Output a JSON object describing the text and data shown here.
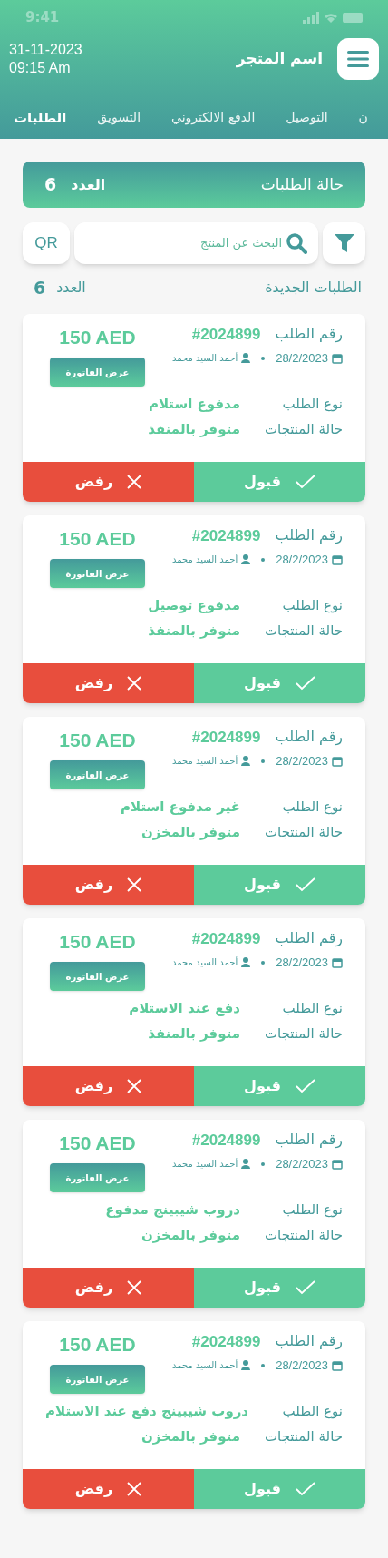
{
  "status_bar": {
    "time": "9:41"
  },
  "header": {
    "title": "اسم المتجر",
    "date": "31-11-2023",
    "time": "09:15 Am"
  },
  "tabs": [
    {
      "label": "ن",
      "selected": false
    },
    {
      "label": "التوصيل",
      "selected": false
    },
    {
      "label": "الدفع الالكتروني",
      "selected": false
    },
    {
      "label": "التسويق",
      "selected": false
    },
    {
      "label": "الطلبات",
      "selected": true
    }
  ],
  "status_card": {
    "title": "حالة الطلبات",
    "count_label": "العدد",
    "count": "6"
  },
  "search": {
    "placeholder": "البحث عن المنتج",
    "qr": "QR"
  },
  "section": {
    "title": "الطلبات الجديدة",
    "count_label": "العدد",
    "count": "6"
  },
  "orders": [
    {
      "order_label": "رقم الطلب",
      "order_number": "#2024899",
      "date": "28/2/2023",
      "customer": "أحمد السيد محمد",
      "price": "150 AED",
      "invoice": "عرض الفاتورة",
      "type_label": "نوع الطلب",
      "type_value": "مدفوع استلام",
      "status_label": "حالة المنتجات",
      "status_value": "متوفر بالمنفذ",
      "accept": "قبول",
      "reject": "رفض"
    },
    {
      "order_label": "رقم الطلب",
      "order_number": "#2024899",
      "date": "28/2/2023",
      "customer": "أحمد السيد محمد",
      "price": "150 AED",
      "invoice": "عرض الفاتورة",
      "type_label": "نوع الطلب",
      "type_value": "مدفوع توصيل",
      "status_label": "حالة المنتجات",
      "status_value": "متوفر بالمنفذ",
      "accept": "قبول",
      "reject": "رفض"
    },
    {
      "order_label": "رقم الطلب",
      "order_number": "#2024899",
      "date": "28/2/2023",
      "customer": "أحمد السيد محمد",
      "price": "150 AED",
      "invoice": "عرض الفاتورة",
      "type_label": "نوع الطلب",
      "type_value": "غير مدفوع استلام",
      "status_label": "حالة المنتجات",
      "status_value": "متوفر بالمخزن",
      "accept": "قبول",
      "reject": "رفض"
    },
    {
      "order_label": "رقم الطلب",
      "order_number": "#2024899",
      "date": "28/2/2023",
      "customer": "أحمد السيد محمد",
      "price": "150 AED",
      "invoice": "عرض الفاتورة",
      "type_label": "نوع الطلب",
      "type_value": "دفع عند الاستلام",
      "status_label": "حالة المنتجات",
      "status_value": "متوفر بالمنفذ",
      "accept": "قبول",
      "reject": "رفض"
    },
    {
      "order_label": "رقم الطلب",
      "order_number": "#2024899",
      "date": "28/2/2023",
      "customer": "أحمد السيد محمد",
      "price": "150 AED",
      "invoice": "عرض الفاتورة",
      "type_label": "نوع الطلب",
      "type_value": "دروب شيبينج مدفوع",
      "status_label": "حالة المنتجات",
      "status_value": "متوفر بالمخزن",
      "accept": "قبول",
      "reject": "رفض"
    },
    {
      "order_label": "رقم الطلب",
      "order_number": "#2024899",
      "date": "28/2/2023",
      "customer": "أحمد السيد محمد",
      "price": "150 AED",
      "invoice": "عرض الفاتورة",
      "type_label": "نوع الطلب",
      "type_value": "دروب شيبينج دفع عند الاستلام",
      "status_label": "حالة المنتجات",
      "status_value": "متوفر بالمخزن",
      "accept": "قبول",
      "reject": "رفض"
    }
  ]
}
